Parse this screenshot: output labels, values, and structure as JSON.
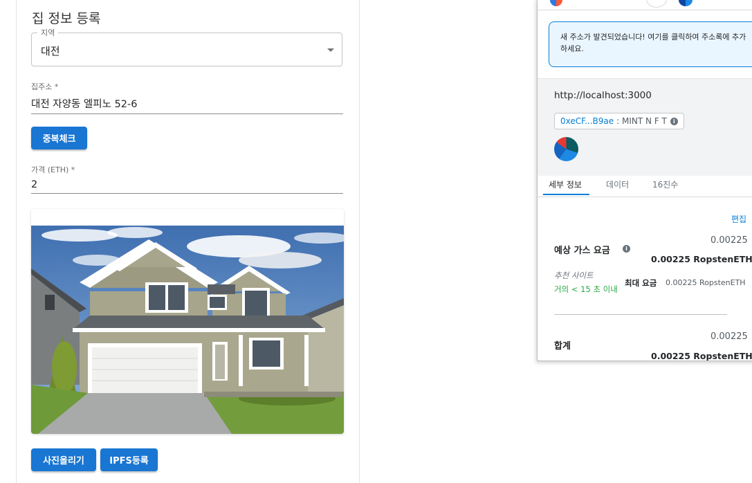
{
  "form": {
    "title": "집 정보 등록",
    "region": {
      "label": "지역",
      "value": "대전"
    },
    "address": {
      "label": "집주소 *",
      "value": "대전 자양동 엘피노 52-6"
    },
    "dup_check_label": "중복체크",
    "price": {
      "label": "가격 (ETH) *",
      "value": "2"
    },
    "upload_label": "사진올리기",
    "ipfs_label": "IPFS등록"
  },
  "metamask": {
    "notice": "새 주소가 발견되었습니다! 여기를 클릭하여 주소록에 추가하세요.",
    "origin": "http://localhost:3000",
    "contract_address": "0xeCF...B9ae",
    "method": ": MINT N F T",
    "tabs": [
      "세부 정보",
      "데이터",
      "16진수"
    ],
    "edit_label": "편집",
    "gas_label": "예상 가스 요금",
    "gas_value": "0.00225",
    "gas_value_bold": "0.00225 RopstenETH",
    "suggest_site": "추천 사이트",
    "time_estimate": "거의 < 15 초 이내",
    "max_fee_label": "최대 요금",
    "max_fee_value": "0.00225 RopstenETH",
    "total_label": "합계",
    "total_value": "0.00225",
    "total_value_bold": "0.00225 RopstenETH"
  },
  "colors": {
    "primary": "#1976d2",
    "mm_blue": "#037dd6",
    "mm_green": "#28a745"
  }
}
